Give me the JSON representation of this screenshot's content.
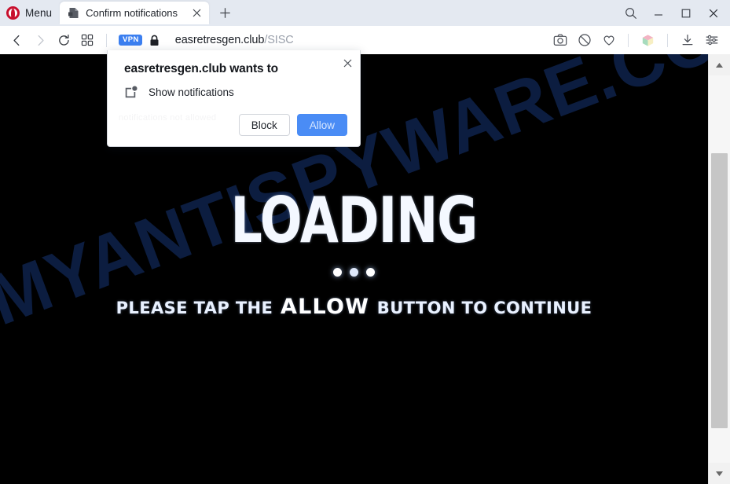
{
  "window": {
    "menu_label": "Menu",
    "opera_logo_icon": "opera-logo-icon",
    "controls": {
      "search_icon": "search-icon",
      "minimize_icon": "minimize-icon",
      "maximize_icon": "maximize-icon",
      "close_icon": "close-icon"
    }
  },
  "tabs": [
    {
      "title": "Confirm notifications",
      "favicon_icon": "page-favicon-icon",
      "close_icon": "tab-close-icon",
      "active": true
    }
  ],
  "new_tab_icon": "plus-icon",
  "toolbar": {
    "back_icon": "chevron-left-icon",
    "forward_icon": "chevron-right-icon",
    "reload_icon": "reload-icon",
    "tiles_icon": "grid-tiles-icon",
    "vpn_badge": "VPN",
    "lock_icon": "padlock-icon",
    "url_domain": "easretresgen.club",
    "url_path": "/SISC",
    "right_icons": [
      {
        "name": "camera-snapshot-icon"
      },
      {
        "name": "ad-blocker-shield-icon"
      },
      {
        "name": "heart-icon"
      },
      {
        "name": "extensions-cube-icon"
      },
      {
        "name": "download-icon"
      },
      {
        "name": "easy-setup-sliders-icon"
      }
    ]
  },
  "permission_dialog": {
    "title": "easretresgen.club wants to",
    "permission_icon": "show-notifications-icon",
    "permission_text": "Show notifications",
    "block_label": "Block",
    "allow_label": "Allow",
    "close_icon": "dialog-close-icon",
    "allow_color": "#4a8cf5"
  },
  "page": {
    "background_color": "#000000",
    "watermark_text": "MYANTISPYWARE.COM",
    "watermark_color": "#0d1f44",
    "loading_title": "LOADING",
    "dots": [
      "dot",
      "dot",
      "dot"
    ],
    "cta_prefix": "PLEASE TAP THE",
    "cta_keyword": "ALLOW",
    "cta_suffix": "BUTTON TO CONTINUE",
    "bleed_text": "notifications not allowed"
  },
  "scrollbar": {
    "up_icon": "scroll-up-arrow-icon",
    "down_icon": "scroll-down-arrow-icon",
    "thumb": "scrollbar-thumb"
  }
}
